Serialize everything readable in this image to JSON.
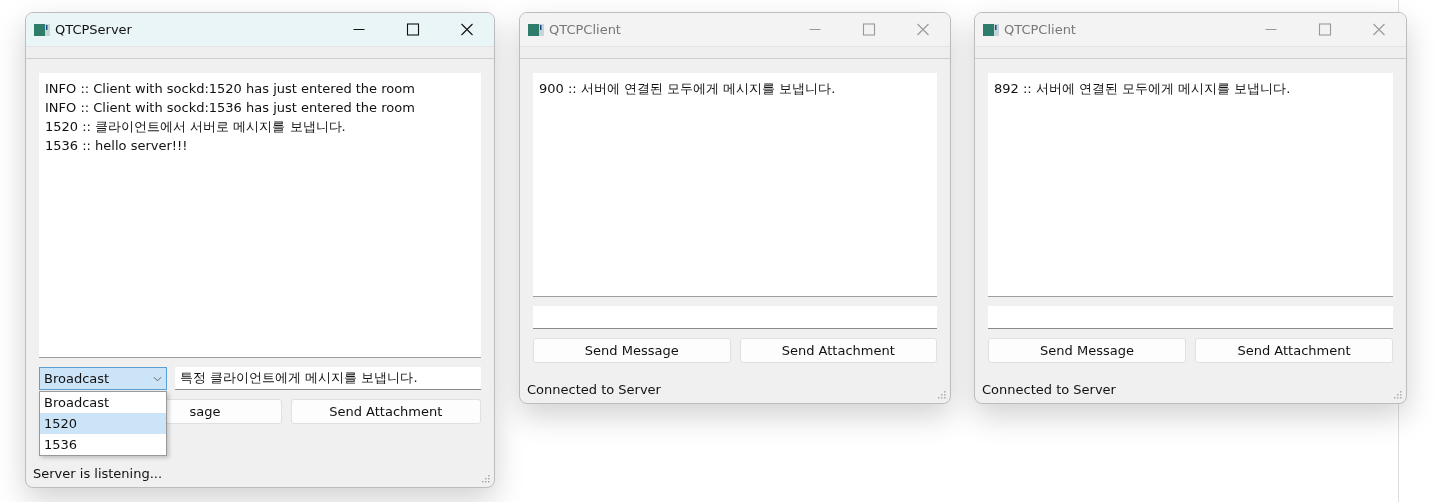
{
  "windows": [
    {
      "kind": "server",
      "title": "QTCPServer",
      "active": true,
      "log": [
        "INFO :: Client with sockd:1520 has just entered the room",
        "INFO :: Client with sockd:1536 has just entered the room",
        "1520 :: 클라이언트에서 서버로 메시지를 보냅니다.",
        "1536 :: hello server!!!"
      ],
      "recipient": {
        "value": "Broadcast",
        "expanded": true,
        "options": [
          {
            "label": "Broadcast",
            "highlighted": false
          },
          {
            "label": "1520",
            "highlighted": true
          },
          {
            "label": "1536",
            "highlighted": false
          }
        ]
      },
      "message": "특정 클라이언트에게 메시지를 보냅니다.",
      "buttons": [
        "sage",
        "Send Attachment"
      ],
      "status": "Server is listening..."
    },
    {
      "kind": "client",
      "title": "QTCPClient",
      "active": false,
      "log": [
        "900 :: 서버에 연결된 모두에게 메시지를 보냅니다."
      ],
      "buttons": [
        "Send Message",
        "Send Attachment"
      ],
      "status": "Connected to Server"
    },
    {
      "kind": "client",
      "title": "QTCPClient",
      "active": false,
      "log": [
        "892 :: 서버에 연결된 모두에게 메시지를 보냅니다."
      ],
      "buttons": [
        "Send Message",
        "Send Attachment"
      ],
      "status": "Connected to Server"
    }
  ]
}
